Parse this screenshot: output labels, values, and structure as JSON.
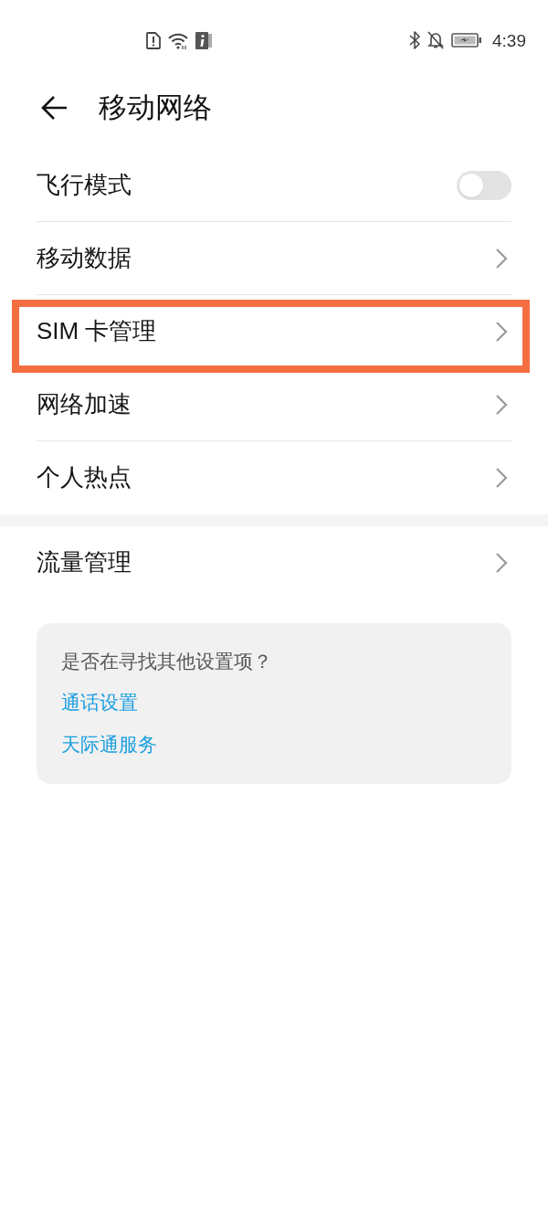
{
  "status_bar": {
    "time": "4:39"
  },
  "header": {
    "title": "移动网络"
  },
  "settings_groups": [
    {
      "items": [
        {
          "label": "飞行模式",
          "kind": "toggle",
          "on": false,
          "highlighted": false
        },
        {
          "label": "移动数据",
          "kind": "link",
          "highlighted": false
        },
        {
          "label": "SIM 卡管理",
          "kind": "link",
          "highlighted": true
        },
        {
          "label": "网络加速",
          "kind": "link",
          "highlighted": false
        },
        {
          "label": "个人热点",
          "kind": "link",
          "highlighted": false
        }
      ]
    },
    {
      "items": [
        {
          "label": "流量管理",
          "kind": "link",
          "highlighted": false
        }
      ]
    }
  ],
  "suggestions": {
    "prompt": "是否在寻找其他设置项？",
    "links": [
      "通话设置",
      "天际通服务"
    ]
  }
}
